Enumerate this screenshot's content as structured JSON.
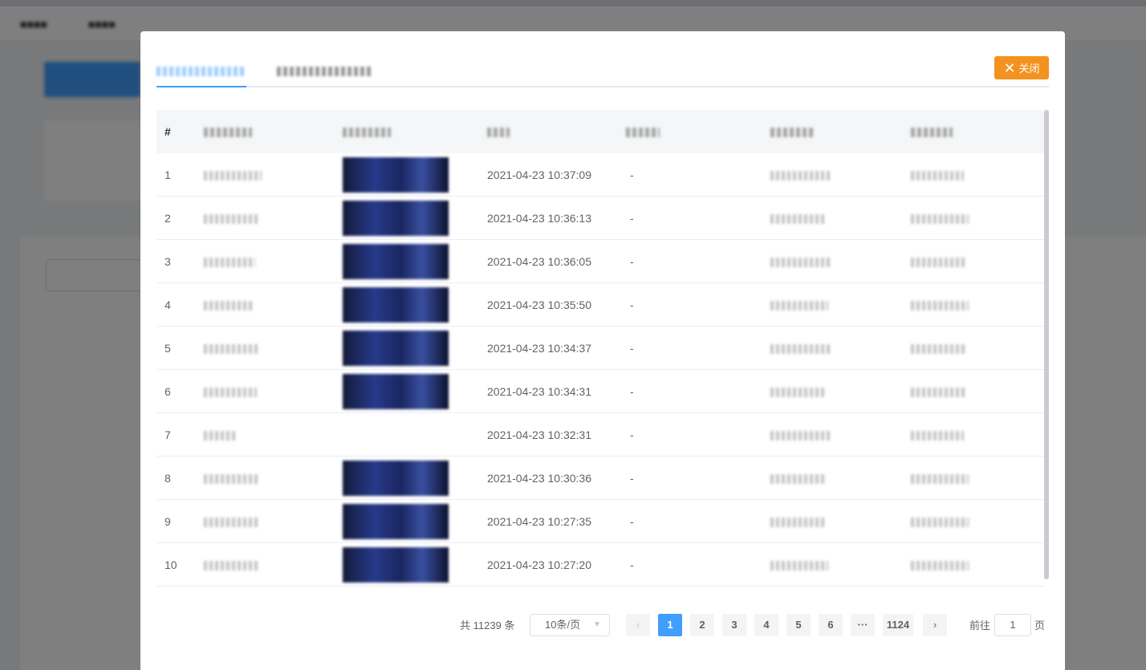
{
  "background": {
    "crumbs": [
      "■■■■",
      "■■■■"
    ]
  },
  "dialog": {
    "tabs": [
      {
        "label": "■■■■■■■■"
      },
      {
        "label": "■■■■■■■■"
      }
    ],
    "close_label": "关闭",
    "table": {
      "columns": [
        "#",
        "■■■■",
        "■■■■",
        "■■",
        "■■■",
        "■■■■",
        "■■■■"
      ],
      "rows": [
        {
          "idx": "1",
          "time": "2021-04-23 10:37:09",
          "dash": "-",
          "has_image": true
        },
        {
          "idx": "2",
          "time": "2021-04-23 10:36:13",
          "dash": "-",
          "has_image": true
        },
        {
          "idx": "3",
          "time": "2021-04-23 10:36:05",
          "dash": "-",
          "has_image": true
        },
        {
          "idx": "4",
          "time": "2021-04-23 10:35:50",
          "dash": "-",
          "has_image": true
        },
        {
          "idx": "5",
          "time": "2021-04-23 10:34:37",
          "dash": "-",
          "has_image": true
        },
        {
          "idx": "6",
          "time": "2021-04-23 10:34:31",
          "dash": "-",
          "has_image": true
        },
        {
          "idx": "7",
          "time": "2021-04-23 10:32:31",
          "dash": "-",
          "has_image": false
        },
        {
          "idx": "8",
          "time": "2021-04-23 10:30:36",
          "dash": "-",
          "has_image": true
        },
        {
          "idx": "9",
          "time": "2021-04-23 10:27:35",
          "dash": "-",
          "has_image": true
        },
        {
          "idx": "10",
          "time": "2021-04-23 10:27:20",
          "dash": "-",
          "has_image": true
        }
      ]
    },
    "pagination": {
      "total": "共 11239 条",
      "page_size": "10条/页",
      "pages": [
        "1",
        "2",
        "3",
        "4",
        "5",
        "6",
        "···",
        "1124"
      ],
      "current": "1",
      "goto_label": "前往",
      "goto_value": "1",
      "page_suffix": "页"
    }
  }
}
